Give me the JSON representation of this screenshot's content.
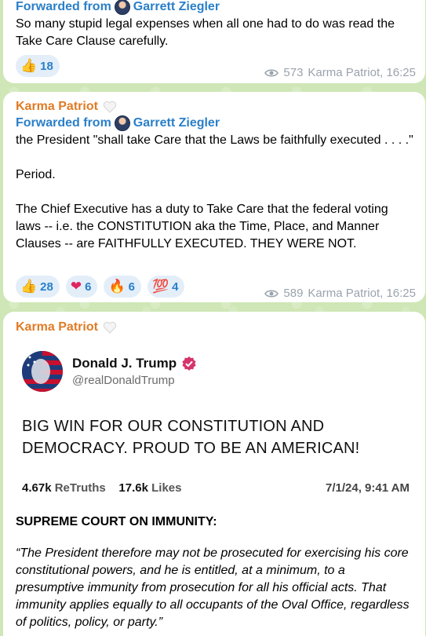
{
  "msg1": {
    "forwarded_prefix": "Forwarded from",
    "forwarded_name": "Garrett Ziegler",
    "text": "So many stupid legal expenses when all one had to do was read the Take Care Clause carefully.",
    "reactions": [
      {
        "emoji": "👍",
        "count": "18"
      }
    ],
    "views": "573",
    "author_time": "Karma Patriot, 16:25"
  },
  "msg2": {
    "sender": "Karma Patriot",
    "forwarded_prefix": "Forwarded from",
    "forwarded_name": "Garrett Ziegler",
    "text": "the President \"shall take Care that the Laws be faithfully executed . . . .\"\n\nPeriod.\n\nThe Chief Executive has a duty to Take Care that the federal voting laws -- i.e. the CONSTITUTION aka the Time, Place, and Manner Clauses -- are FAITHFULLY EXECUTED. THEY WERE NOT.",
    "reactions": [
      {
        "emoji": "👍",
        "count": "28"
      },
      {
        "emoji": "❤",
        "count": "6"
      },
      {
        "emoji": "🔥",
        "count": "6"
      },
      {
        "emoji": "💯",
        "count": "4"
      }
    ],
    "views": "589",
    "author_time": "Karma Patriot, 16:25"
  },
  "msg3": {
    "sender": "Karma Patriot",
    "tweet": {
      "name": "Donald J. Trump",
      "handle": "@realDonaldTrump",
      "body": "BIG WIN FOR OUR CONSTITUTION AND DEMOCRACY. PROUD TO BE AN AMERICAN!",
      "retruths_count": "4.67k",
      "retruths_label": "ReTruths",
      "likes_count": "17.6k",
      "likes_label": "Likes",
      "date": "7/1/24, 9:41 AM"
    },
    "heading": "SUPREME COURT ON IMMUNITY:",
    "quote": "“The President therefore may not be prosecuted for exercising his core constitutional powers, and he is entitled, at a minimum, to a presumptive immunity from prosecution for all his official acts. That immunity applies equally to all occupants of the Oval Office, regardless of politics, policy, or party.”"
  },
  "colors": {
    "sender": "#e07b25",
    "forwarded": "#2a7fc9",
    "reaction_bg": "#e3eef9",
    "meta": "#9aa3ad",
    "chat_bg": "#cfe6b6"
  }
}
